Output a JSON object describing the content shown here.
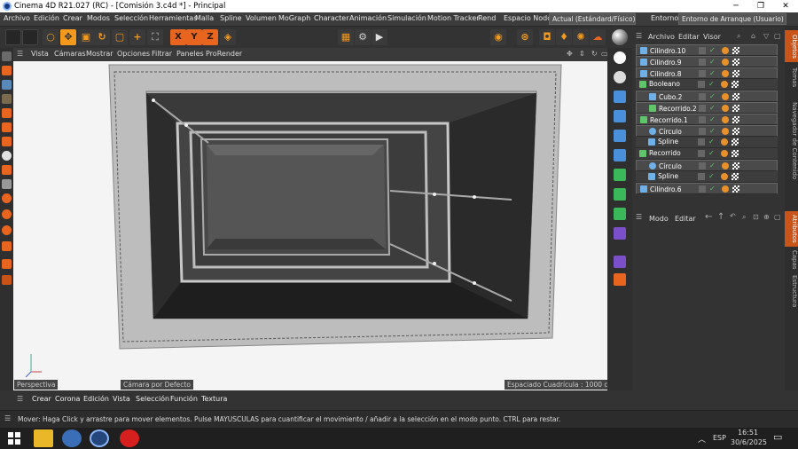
{
  "window": {
    "title": "Cinema 4D R21.027 (RC) - [Comisión 3.c4d *] - Principal",
    "controls": [
      "─",
      "❐",
      "✕"
    ]
  },
  "menubar": {
    "items": [
      "Archivo",
      "Edición",
      "Crear",
      "Modos",
      "Selección",
      "Herramientas",
      "Malla",
      "Spline",
      "Volumen",
      "MoGraph",
      "Character",
      "Animación",
      "Simulación",
      "Motion Tracker",
      "Rend"
    ],
    "node_space_label": "Espacio Nodo:",
    "node_space_value": "Actual (Estándard/Físico)",
    "env_label": "Entorno:",
    "env_value": "Entorno de Arranque (Usuario)"
  },
  "toolbar": {
    "axis": [
      "X",
      "Y",
      "Z"
    ]
  },
  "viewport": {
    "menu": [
      "Vista",
      "Cámaras",
      "Mostrar",
      "Opciones",
      "Filtrar",
      "Paneles",
      "ProRender"
    ],
    "view_name": "Perspectiva",
    "camera": "Cámara por Defecto",
    "grid": "Espaciado Cuadrícula : 1000 cm"
  },
  "objects": {
    "menu": [
      "Archivo",
      "Editar",
      "Visor"
    ],
    "rows": [
      {
        "name": "Cilindro.10",
        "icon": "cylinder-icon",
        "indent": 0,
        "sel": true
      },
      {
        "name": "Cilindro.9",
        "icon": "cylinder-icon",
        "indent": 0,
        "sel": true
      },
      {
        "name": "Cilindro.8",
        "icon": "cylinder-icon",
        "indent": 0,
        "sel": true
      },
      {
        "name": "Booleano",
        "icon": "boolean-icon",
        "indent": 0,
        "sel": false
      },
      {
        "name": "Cubo.2",
        "icon": "cube-icon",
        "indent": 1,
        "sel": true
      },
      {
        "name": "Recorrido.2",
        "icon": "sweep-icon",
        "indent": 1,
        "sel": true
      },
      {
        "name": "Recorrido.1",
        "icon": "sweep-icon",
        "indent": 0,
        "sel": true
      },
      {
        "name": "Círculo",
        "icon": "circle-icon",
        "indent": 1,
        "sel": true
      },
      {
        "name": "Spline",
        "icon": "spline-icon",
        "indent": 1,
        "sel": false
      },
      {
        "name": "Recorrido",
        "icon": "sweep-icon",
        "indent": 0,
        "sel": false
      },
      {
        "name": "Círculo",
        "icon": "circle-icon",
        "indent": 1,
        "sel": true
      },
      {
        "name": "Spline",
        "icon": "spline-icon",
        "indent": 1,
        "sel": false
      },
      {
        "name": "Cilindro.6",
        "icon": "cylinder-icon",
        "indent": 0,
        "sel": true
      }
    ]
  },
  "attributes": {
    "menu": [
      "Modo",
      "Editar"
    ]
  },
  "right_tabs": [
    "Objetos",
    "Tomas",
    "Navegador de Contenido",
    "Atributos",
    "Capas",
    "Estructura"
  ],
  "timeline": {
    "menu": [
      "Crear",
      "Corona",
      "Edición",
      "Vista",
      "Selección",
      "Función",
      "Textura"
    ]
  },
  "status": "Mover: Haga Click y arrastre para mover elementos. Pulse MAYUSCULAS para cuantificar el movimiento / añadir a la selección en el modo punto. CTRL para restar.",
  "taskbar": {
    "lang": "ESP",
    "time": "16:51",
    "date": "30/6/2025"
  }
}
